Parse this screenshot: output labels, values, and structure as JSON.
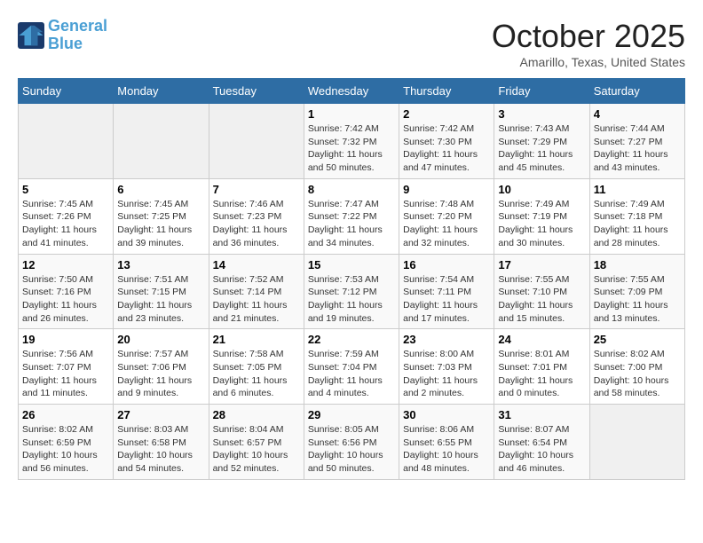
{
  "header": {
    "logo_line1": "General",
    "logo_line2": "Blue",
    "month": "October 2025",
    "location": "Amarillo, Texas, United States"
  },
  "weekdays": [
    "Sunday",
    "Monday",
    "Tuesday",
    "Wednesday",
    "Thursday",
    "Friday",
    "Saturday"
  ],
  "weeks": [
    [
      {
        "day": "",
        "info": ""
      },
      {
        "day": "",
        "info": ""
      },
      {
        "day": "",
        "info": ""
      },
      {
        "day": "1",
        "info": "Sunrise: 7:42 AM\nSunset: 7:32 PM\nDaylight: 11 hours\nand 50 minutes."
      },
      {
        "day": "2",
        "info": "Sunrise: 7:42 AM\nSunset: 7:30 PM\nDaylight: 11 hours\nand 47 minutes."
      },
      {
        "day": "3",
        "info": "Sunrise: 7:43 AM\nSunset: 7:29 PM\nDaylight: 11 hours\nand 45 minutes."
      },
      {
        "day": "4",
        "info": "Sunrise: 7:44 AM\nSunset: 7:27 PM\nDaylight: 11 hours\nand 43 minutes."
      }
    ],
    [
      {
        "day": "5",
        "info": "Sunrise: 7:45 AM\nSunset: 7:26 PM\nDaylight: 11 hours\nand 41 minutes."
      },
      {
        "day": "6",
        "info": "Sunrise: 7:45 AM\nSunset: 7:25 PM\nDaylight: 11 hours\nand 39 minutes."
      },
      {
        "day": "7",
        "info": "Sunrise: 7:46 AM\nSunset: 7:23 PM\nDaylight: 11 hours\nand 36 minutes."
      },
      {
        "day": "8",
        "info": "Sunrise: 7:47 AM\nSunset: 7:22 PM\nDaylight: 11 hours\nand 34 minutes."
      },
      {
        "day": "9",
        "info": "Sunrise: 7:48 AM\nSunset: 7:20 PM\nDaylight: 11 hours\nand 32 minutes."
      },
      {
        "day": "10",
        "info": "Sunrise: 7:49 AM\nSunset: 7:19 PM\nDaylight: 11 hours\nand 30 minutes."
      },
      {
        "day": "11",
        "info": "Sunrise: 7:49 AM\nSunset: 7:18 PM\nDaylight: 11 hours\nand 28 minutes."
      }
    ],
    [
      {
        "day": "12",
        "info": "Sunrise: 7:50 AM\nSunset: 7:16 PM\nDaylight: 11 hours\nand 26 minutes."
      },
      {
        "day": "13",
        "info": "Sunrise: 7:51 AM\nSunset: 7:15 PM\nDaylight: 11 hours\nand 23 minutes."
      },
      {
        "day": "14",
        "info": "Sunrise: 7:52 AM\nSunset: 7:14 PM\nDaylight: 11 hours\nand 21 minutes."
      },
      {
        "day": "15",
        "info": "Sunrise: 7:53 AM\nSunset: 7:12 PM\nDaylight: 11 hours\nand 19 minutes."
      },
      {
        "day": "16",
        "info": "Sunrise: 7:54 AM\nSunset: 7:11 PM\nDaylight: 11 hours\nand 17 minutes."
      },
      {
        "day": "17",
        "info": "Sunrise: 7:55 AM\nSunset: 7:10 PM\nDaylight: 11 hours\nand 15 minutes."
      },
      {
        "day": "18",
        "info": "Sunrise: 7:55 AM\nSunset: 7:09 PM\nDaylight: 11 hours\nand 13 minutes."
      }
    ],
    [
      {
        "day": "19",
        "info": "Sunrise: 7:56 AM\nSunset: 7:07 PM\nDaylight: 11 hours\nand 11 minutes."
      },
      {
        "day": "20",
        "info": "Sunrise: 7:57 AM\nSunset: 7:06 PM\nDaylight: 11 hours\nand 9 minutes."
      },
      {
        "day": "21",
        "info": "Sunrise: 7:58 AM\nSunset: 7:05 PM\nDaylight: 11 hours\nand 6 minutes."
      },
      {
        "day": "22",
        "info": "Sunrise: 7:59 AM\nSunset: 7:04 PM\nDaylight: 11 hours\nand 4 minutes."
      },
      {
        "day": "23",
        "info": "Sunrise: 8:00 AM\nSunset: 7:03 PM\nDaylight: 11 hours\nand 2 minutes."
      },
      {
        "day": "24",
        "info": "Sunrise: 8:01 AM\nSunset: 7:01 PM\nDaylight: 11 hours\nand 0 minutes."
      },
      {
        "day": "25",
        "info": "Sunrise: 8:02 AM\nSunset: 7:00 PM\nDaylight: 10 hours\nand 58 minutes."
      }
    ],
    [
      {
        "day": "26",
        "info": "Sunrise: 8:02 AM\nSunset: 6:59 PM\nDaylight: 10 hours\nand 56 minutes."
      },
      {
        "day": "27",
        "info": "Sunrise: 8:03 AM\nSunset: 6:58 PM\nDaylight: 10 hours\nand 54 minutes."
      },
      {
        "day": "28",
        "info": "Sunrise: 8:04 AM\nSunset: 6:57 PM\nDaylight: 10 hours\nand 52 minutes."
      },
      {
        "day": "29",
        "info": "Sunrise: 8:05 AM\nSunset: 6:56 PM\nDaylight: 10 hours\nand 50 minutes."
      },
      {
        "day": "30",
        "info": "Sunrise: 8:06 AM\nSunset: 6:55 PM\nDaylight: 10 hours\nand 48 minutes."
      },
      {
        "day": "31",
        "info": "Sunrise: 8:07 AM\nSunset: 6:54 PM\nDaylight: 10 hours\nand 46 minutes."
      },
      {
        "day": "",
        "info": ""
      }
    ]
  ]
}
